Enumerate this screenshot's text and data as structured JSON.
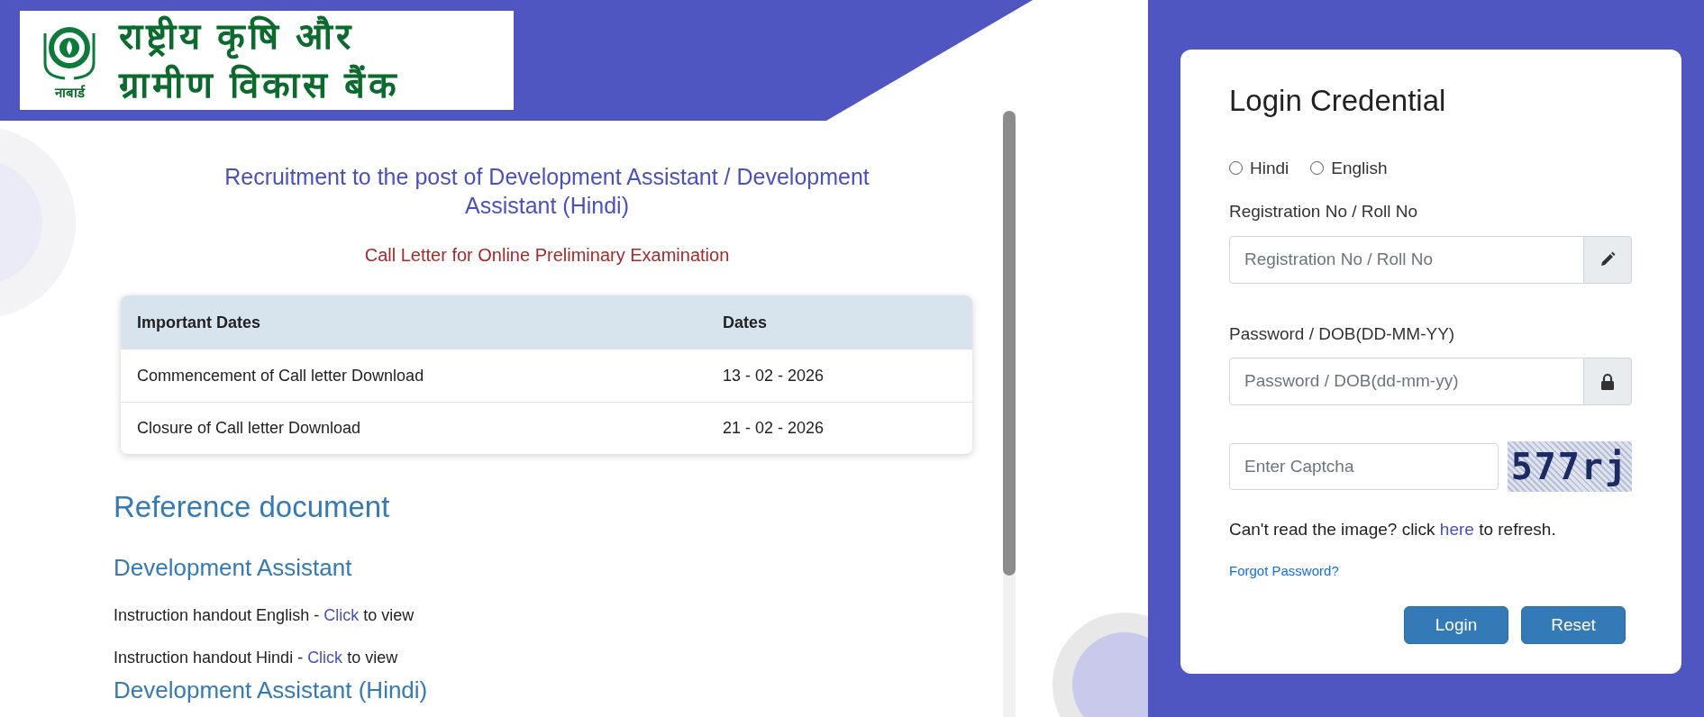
{
  "logo": {
    "emblem_caption": "नाबार्ड",
    "lines": [
      "राष्ट्रीय कृषि और",
      "ग्रामीण विकास बैंक"
    ]
  },
  "main": {
    "title": "Recruitment to the post of Development Assistant / Development Assistant (Hindi)",
    "subtitle": "Call Letter for Online Preliminary Examination",
    "table": {
      "columns": [
        "Important Dates",
        "Dates"
      ],
      "rows": [
        [
          "Commencement of Call letter Download",
          "13 - 02 - 2026"
        ],
        [
          "Closure of Call letter Download",
          "21 - 02 - 2026"
        ]
      ]
    },
    "reference": {
      "heading": "Reference document",
      "sections": [
        {
          "title": "Development Assistant",
          "items": [
            {
              "before": "Instruction handout English - ",
              "link": "Click",
              "after": " to view"
            },
            {
              "before": "Instruction handout Hindi - ",
              "link": "Click",
              "after": " to view"
            }
          ]
        },
        {
          "title": "Development Assistant (Hindi)"
        }
      ]
    }
  },
  "login": {
    "title": "Login Credential",
    "languages": [
      {
        "label": "Hindi",
        "selected": false
      },
      {
        "label": "English",
        "selected": false
      }
    ],
    "fields": [
      {
        "label": "Registration No / Roll No",
        "placeholder": "Registration No / Roll No",
        "kind": "pencil"
      },
      {
        "label": "Password / DOB(DD-MM-YY)",
        "placeholder": "Password / DOB(dd-mm-yy)",
        "kind": "lock"
      }
    ],
    "captcha": {
      "placeholder": "Enter Captcha",
      "code": "577rj"
    },
    "refresh": {
      "before": "Can't read the image? click ",
      "link": "here",
      "after": " to refresh."
    },
    "forgot": "Forgot Password?",
    "buttons": [
      "Login",
      "Reset"
    ]
  }
}
